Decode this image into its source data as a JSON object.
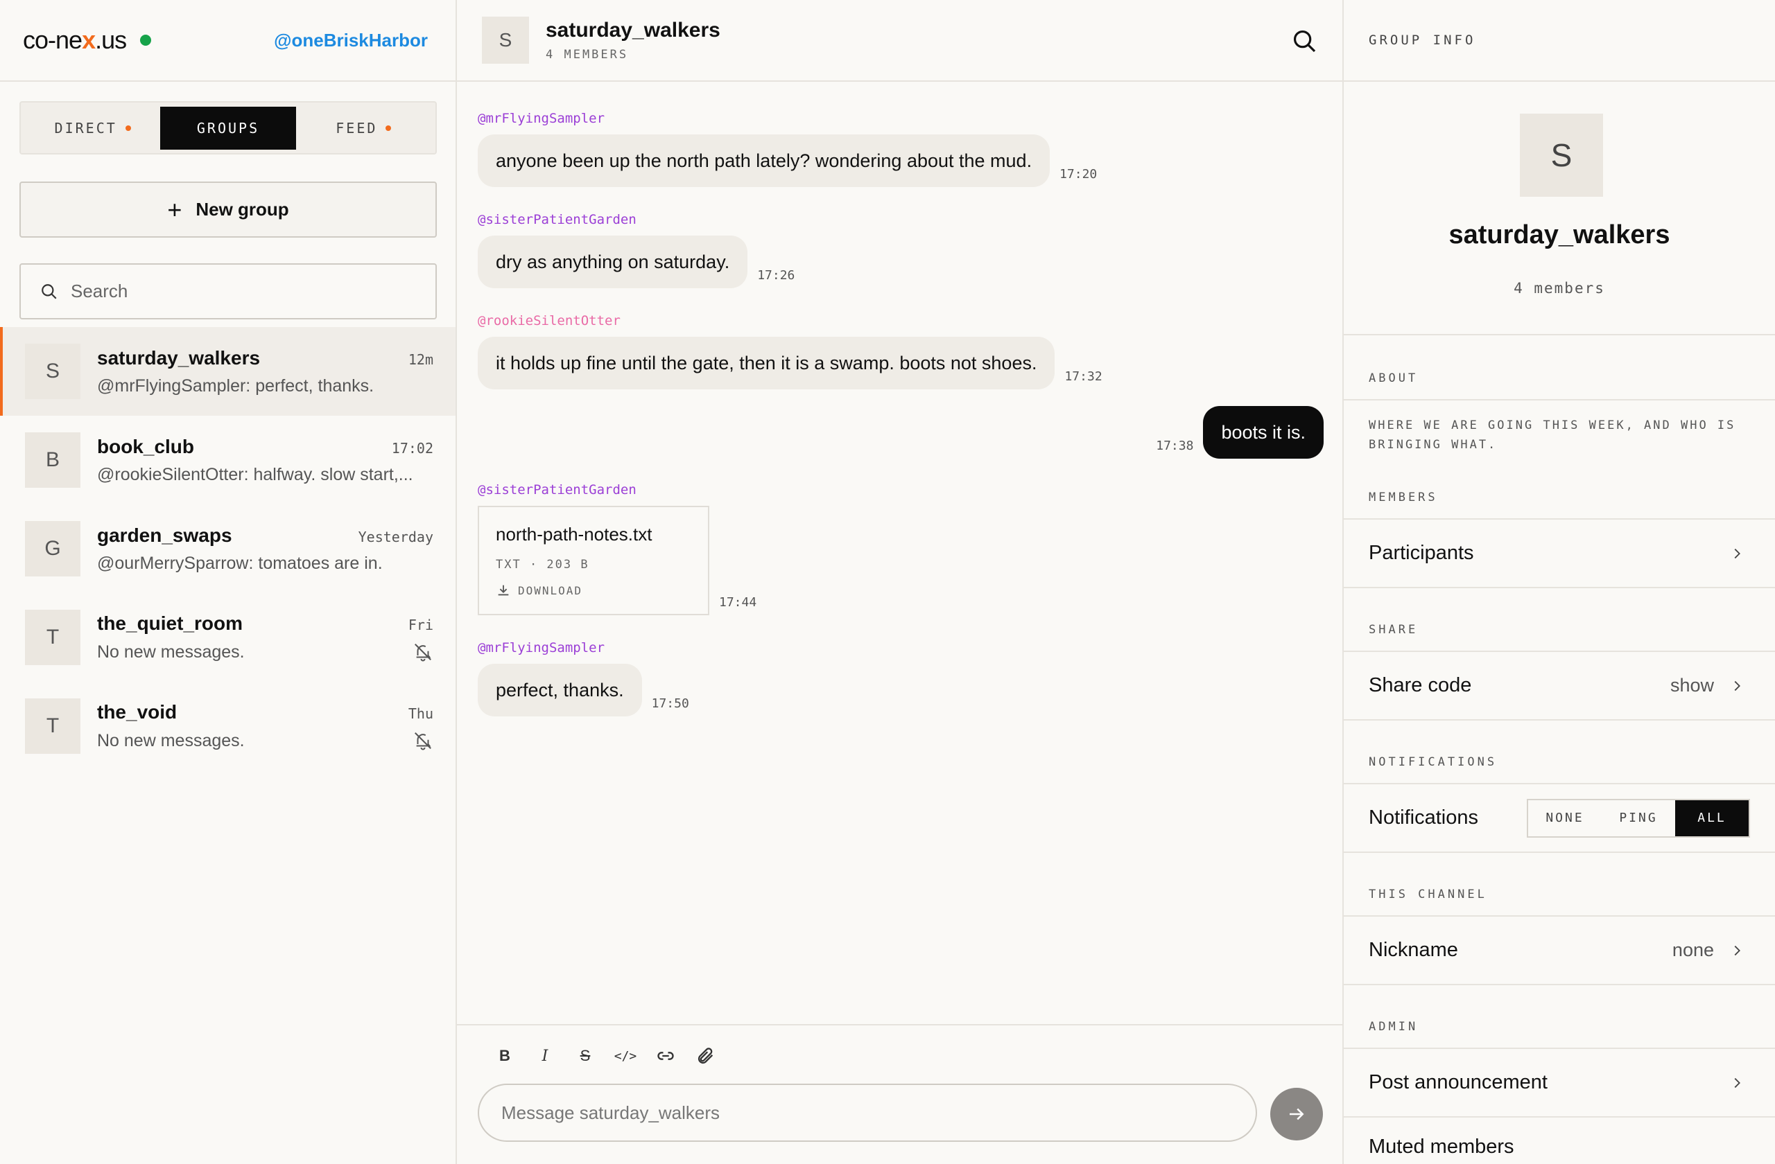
{
  "app": {
    "logo_prefix": "co-ne",
    "logo_mark": "x",
    "logo_suffix": ".us",
    "handle": "@oneBriskHarbor",
    "accent": "#f26b1d",
    "online_color": "#16a34a"
  },
  "tabs": [
    {
      "label": "DIRECT",
      "dot": true
    },
    {
      "label": "GROUPS",
      "active": true
    },
    {
      "label": "FEED",
      "dot": true
    }
  ],
  "sidebar": {
    "new_group_label": "New group",
    "search_placeholder": "Search",
    "conversations": [
      {
        "initial": "S",
        "name": "saturday_walkers",
        "time": "12m",
        "preview": "@mrFlyingSampler: perfect, thanks.",
        "active": true
      },
      {
        "initial": "B",
        "name": "book_club",
        "time": "17:02",
        "preview": "@rookieSilentOtter: halfway. slow start,..."
      },
      {
        "initial": "G",
        "name": "garden_swaps",
        "time": "Yesterday",
        "preview": "@ourMerrySparrow: tomatoes are in."
      },
      {
        "initial": "T",
        "name": "the_quiet_room",
        "time": "Fri",
        "preview": "No new messages.",
        "muted": true
      },
      {
        "initial": "T",
        "name": "the_void",
        "time": "Thu",
        "preview": "No new messages.",
        "muted": true
      }
    ]
  },
  "chat": {
    "initial": "S",
    "title": "saturday_walkers",
    "subtitle": "4 MEMBERS",
    "messages": [
      {
        "author": "@mrFlyingSampler",
        "text": "anyone been up the north path lately? wondering about the mud.",
        "time": "17:20"
      },
      {
        "author": "@sisterPatientGarden",
        "text": "dry as anything on saturday.",
        "time": "17:26"
      },
      {
        "author": "@rookieSilentOtter",
        "text": "it holds up fine until the gate, then it is a swamp. boots not shoes.",
        "time": "17:32"
      },
      {
        "own": true,
        "text": "boots it is.",
        "time": "17:38"
      },
      {
        "author": "@sisterPatientGarden",
        "file": {
          "name": "north-path-notes.txt",
          "meta": "TXT · 203 B",
          "action": "DOWNLOAD"
        },
        "time": "17:44"
      },
      {
        "author": "@mrFlyingSampler",
        "text": "perfect, thanks.",
        "time": "17:50"
      }
    ],
    "composer": {
      "placeholder": "Message saturday_walkers",
      "tools": [
        "B",
        "I",
        "S",
        "</>"
      ]
    }
  },
  "info": {
    "header": "GROUP INFO",
    "initial": "S",
    "title": "saturday_walkers",
    "count": "4 members",
    "about_label": "ABOUT",
    "about_text": "WHERE WE ARE GOING THIS WEEK, AND WHO IS BRINGING WHAT.",
    "members_label": "MEMBERS",
    "participants_label": "Participants",
    "share_label": "SHARE",
    "share_code_label": "Share code",
    "share_code_value": "show",
    "notifications_label": "NOTIFICATIONS",
    "notifications_row_label": "Notifications",
    "notif_options": [
      "NONE",
      "PING",
      "ALL"
    ],
    "notif_selected": "ALL",
    "channel_label": "THIS CHANNEL",
    "nickname_label": "Nickname",
    "nickname_value": "none",
    "admin_label": "ADMIN",
    "post_announcement_label": "Post announcement",
    "muted_members_label": "Muted members"
  }
}
